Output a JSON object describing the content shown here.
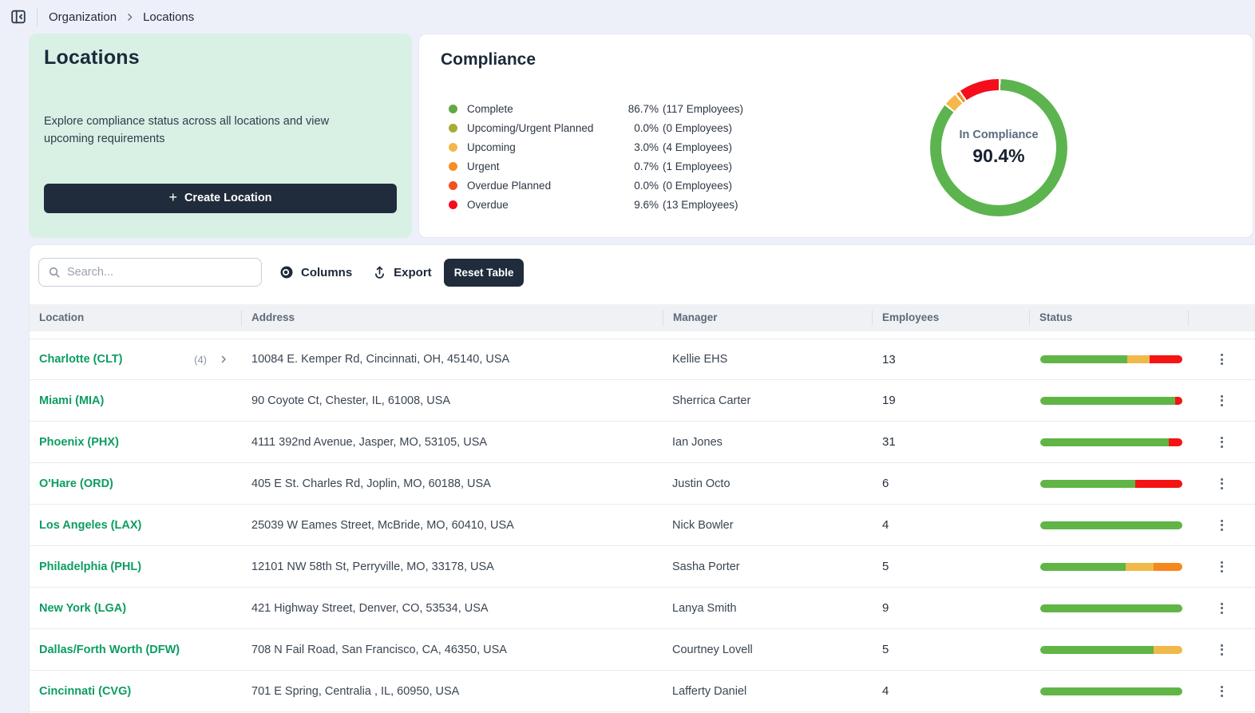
{
  "breadcrumb": {
    "items": [
      "Organization",
      "Locations"
    ]
  },
  "locations_card": {
    "title": "Locations",
    "description": "Explore compliance status across all locations and view upcoming requirements",
    "create_button": "Create Location"
  },
  "compliance": {
    "title": "Compliance",
    "legend": [
      {
        "label": "Complete",
        "pct": "86.7%",
        "detail": "(117 Employees)",
        "color": "#62a944"
      },
      {
        "label": "Upcoming/Urgent Planned",
        "pct": "0.0%",
        "detail": "(0 Employees)",
        "color": "#a8ab39"
      },
      {
        "label": "Upcoming",
        "pct": "3.0%",
        "detail": "(4 Employees)",
        "color": "#f5b74a"
      },
      {
        "label": "Urgent",
        "pct": "0.7%",
        "detail": "(1 Employees)",
        "color": "#f78d23"
      },
      {
        "label": "Overdue Planned",
        "pct": "0.0%",
        "detail": "(0 Employees)",
        "color": "#f4511e"
      },
      {
        "label": "Overdue",
        "pct": "9.6%",
        "detail": "(13 Employees)",
        "color": "#f60d1c"
      }
    ],
    "donut": {
      "center_label": "In Compliance",
      "center_value": "90.4%"
    }
  },
  "chart_data": {
    "type": "pie",
    "subtype": "donut",
    "title": "Compliance",
    "categories": [
      "Complete",
      "Upcoming/Urgent Planned",
      "Upcoming",
      "Urgent",
      "Overdue Planned",
      "Overdue"
    ],
    "values_pct": [
      86.7,
      0.0,
      3.0,
      0.7,
      0.0,
      9.6
    ],
    "employees": [
      117,
      0,
      4,
      1,
      0,
      13
    ],
    "colors": [
      "#5cb44f",
      "#a8ab39",
      "#f5b74a",
      "#f78d23",
      "#f4511e",
      "#f60d1c"
    ],
    "center_label": "In Compliance",
    "center_value": "90.4%",
    "legend_position": "left"
  },
  "toolbar": {
    "search_placeholder": "Search...",
    "columns_label": "Columns",
    "export_label": "Export",
    "reset_label": "Reset Table"
  },
  "table": {
    "columns": [
      "Location",
      "Address",
      "Manager",
      "Employees",
      "Status"
    ],
    "status_colors": {
      "green": "#61b546",
      "yellow": "#f0b949",
      "orange": "#f6871f",
      "red": "#f51414"
    },
    "rows": [
      {
        "location": "Charlotte (CLT)",
        "count": "(4)",
        "expandable": true,
        "address": "10084 E. Kemper Rd, Cincinnati, OH, 45140, USA",
        "manager": "Kellie EHS",
        "employees": "13",
        "status": [
          {
            "color": "green",
            "pct": 61.5
          },
          {
            "color": "yellow",
            "pct": 15.4
          },
          {
            "color": "red",
            "pct": 23.1
          }
        ]
      },
      {
        "location": "Miami (MIA)",
        "address": "90 Coyote Ct, Chester, IL, 61008, USA",
        "manager": "Sherrica Carter",
        "employees": "19",
        "status": [
          {
            "color": "green",
            "pct": 94.7
          },
          {
            "color": "red",
            "pct": 5.3
          }
        ]
      },
      {
        "location": "Phoenix (PHX)",
        "address": "4111 392nd Avenue, Jasper, MO, 53105, USA",
        "manager": "Ian Jones",
        "employees": "31",
        "status": [
          {
            "color": "green",
            "pct": 90.3
          },
          {
            "color": "red",
            "pct": 9.7
          }
        ]
      },
      {
        "location": "O'Hare (ORD)",
        "address": "405 E St. Charles Rd, Joplin, MO, 60188, USA",
        "manager": "Justin Octo",
        "employees": "6",
        "status": [
          {
            "color": "green",
            "pct": 66.7
          },
          {
            "color": "red",
            "pct": 33.3
          }
        ]
      },
      {
        "location": "Los Angeles (LAX)",
        "address": "25039 W Eames Street, McBride, MO, 60410, USA",
        "manager": "Nick Bowler",
        "employees": "4",
        "status": [
          {
            "color": "green",
            "pct": 100
          }
        ]
      },
      {
        "location": "Philadelphia (PHL)",
        "address": "12101 NW 58th St, Perryville, MO, 33178, USA",
        "manager": "Sasha Porter",
        "employees": "5",
        "status": [
          {
            "color": "green",
            "pct": 60
          },
          {
            "color": "yellow",
            "pct": 20
          },
          {
            "color": "orange",
            "pct": 20
          }
        ]
      },
      {
        "location": "New York (LGA)",
        "address": "421 Highway Street, Denver, CO, 53534, USA",
        "manager": "Lanya Smith",
        "employees": "9",
        "status": [
          {
            "color": "green",
            "pct": 100
          }
        ]
      },
      {
        "location": "Dallas/Forth Worth (DFW)",
        "address": "708 N Fail Road, San Francisco, CA, 46350, USA",
        "manager": "Courtney Lovell",
        "employees": "5",
        "status": [
          {
            "color": "green",
            "pct": 80
          },
          {
            "color": "yellow",
            "pct": 20
          }
        ]
      },
      {
        "location": "Cincinnati (CVG)",
        "address": "701 E Spring, Centralia , IL, 60950, USA",
        "manager": "Lafferty Daniel",
        "employees": "4",
        "status": [
          {
            "color": "green",
            "pct": 100
          }
        ]
      }
    ]
  }
}
